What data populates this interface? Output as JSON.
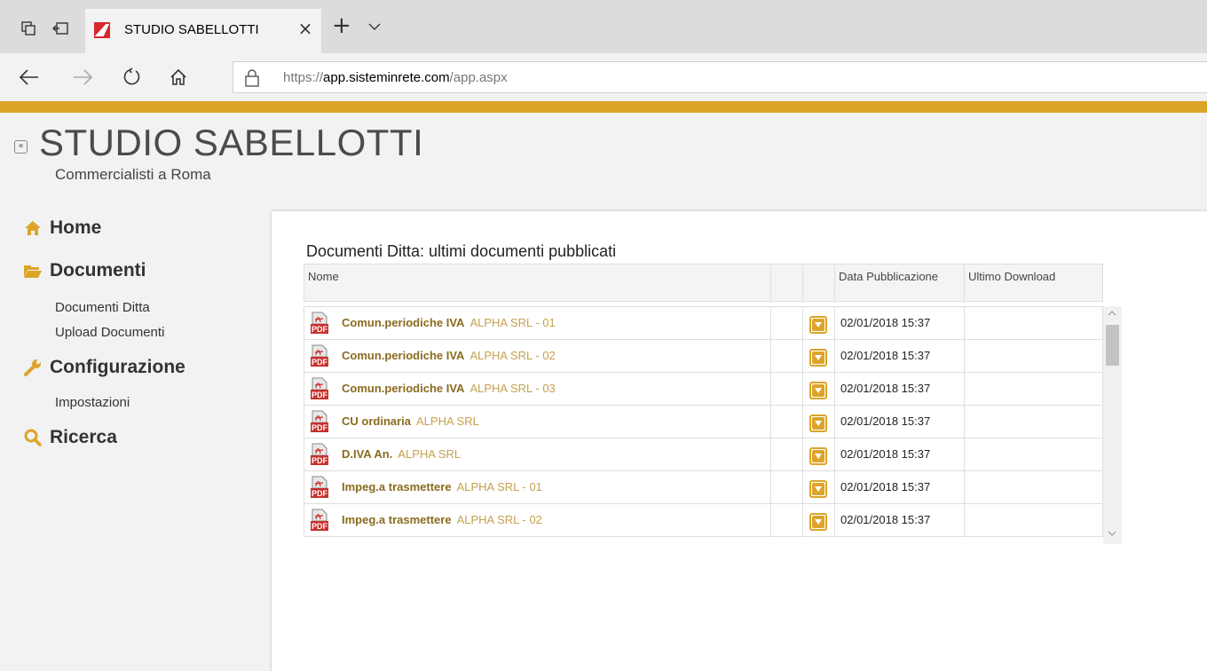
{
  "browser": {
    "tab_title": "STUDIO SABELLOTTI",
    "tab_close": "×",
    "tab_new": "+",
    "url_scheme": "https://",
    "url_host": "app.sisteminrete.com",
    "url_path": "/app.aspx"
  },
  "brand": {
    "accent_color": "#dca429",
    "title": "STUDIO SABELLOTTI",
    "subtitle": "Commercialisti a Roma",
    "collapse_glyph": "«"
  },
  "sidebar": {
    "home": "Home",
    "documenti": "Documenti",
    "documenti_items": [
      "Documenti Ditta",
      "Upload Documenti"
    ],
    "configurazione": "Configurazione",
    "configurazione_items": [
      "Impostazioni"
    ],
    "ricerca": "Ricerca"
  },
  "main": {
    "section_title": "Documenti Ditta: ultimi documenti pubblicati",
    "columns": [
      "Nome",
      "",
      "",
      "Data Pubblicazione",
      "Ultimo Download"
    ],
    "rows": [
      {
        "title": "Comun.periodiche IVA",
        "subtitle": "ALPHA SRL - 01",
        "date": "02/01/2018 15:37",
        "last_download": ""
      },
      {
        "title": "Comun.periodiche IVA",
        "subtitle": "ALPHA SRL - 02",
        "date": "02/01/2018 15:37",
        "last_download": ""
      },
      {
        "title": "Comun.periodiche IVA",
        "subtitle": "ALPHA SRL - 03",
        "date": "02/01/2018 15:37",
        "last_download": ""
      },
      {
        "title": "CU ordinaria",
        "subtitle": "ALPHA SRL",
        "date": "02/01/2018 15:37",
        "last_download": ""
      },
      {
        "title": "D.IVA An.",
        "subtitle": "ALPHA SRL",
        "date": "02/01/2018 15:37",
        "last_download": ""
      },
      {
        "title": "Impeg.a trasmettere",
        "subtitle": "ALPHA SRL - 01",
        "date": "02/01/2018 15:37",
        "last_download": ""
      },
      {
        "title": "Impeg.a trasmettere",
        "subtitle": "ALPHA SRL - 02",
        "date": "02/01/2018 15:37",
        "last_download": ""
      }
    ]
  }
}
